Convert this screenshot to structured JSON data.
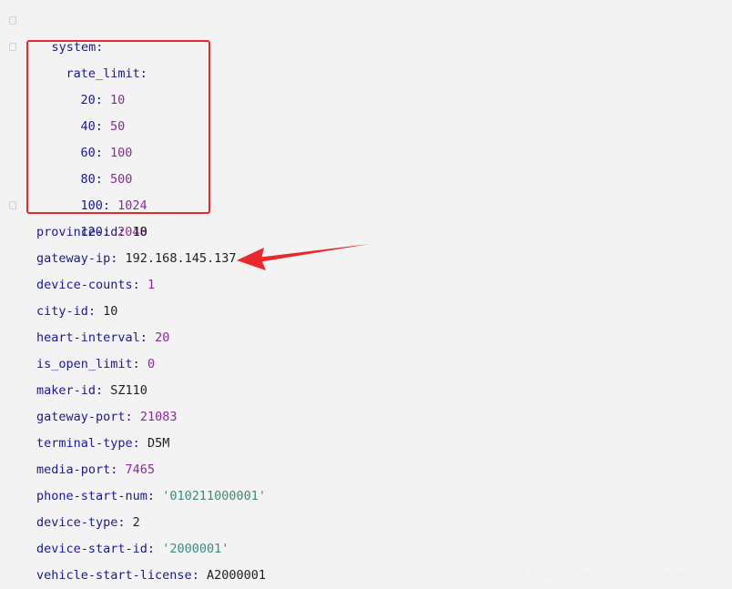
{
  "editor": {
    "root_key": "system",
    "rate_limit_key": "rate_limit",
    "rate_limit": [
      {
        "key": "20",
        "value": "10"
      },
      {
        "key": "40",
        "value": "50"
      },
      {
        "key": "60",
        "value": "100"
      },
      {
        "key": "80",
        "value": "500"
      },
      {
        "key": "100",
        "value": "1024"
      },
      {
        "key": "120",
        "value": "2048"
      }
    ],
    "entries": [
      {
        "key": "province-id",
        "value": "10",
        "kind": "plain"
      },
      {
        "key": "gateway-ip",
        "value": "192.168.145.137",
        "kind": "plain"
      },
      {
        "key": "device-counts",
        "value": "1",
        "kind": "num"
      },
      {
        "key": "city-id",
        "value": "10",
        "kind": "plain"
      },
      {
        "key": "heart-interval",
        "value": "20",
        "kind": "num"
      },
      {
        "key": "is_open_limit",
        "value": "0",
        "kind": "num"
      },
      {
        "key": "maker-id",
        "value": "SZ110",
        "kind": "plain"
      },
      {
        "key": "gateway-port",
        "value": "21083",
        "kind": "num"
      },
      {
        "key": "terminal-type",
        "value": "D5M",
        "kind": "plain"
      },
      {
        "key": "media-port",
        "value": "7465",
        "kind": "num"
      },
      {
        "key": "phone-start-num",
        "value": "'010211000001'",
        "kind": "str"
      },
      {
        "key": "device-type",
        "value": "2",
        "kind": "plain"
      },
      {
        "key": "device-start-id",
        "value": "'2000001'",
        "kind": "str"
      },
      {
        "key": "vehicle-start-license",
        "value": "A2000001",
        "kind": "plain"
      }
    ]
  },
  "annotations": {
    "highlight_color": "#e8282a",
    "arrow_color": "#e8282a"
  },
  "colors": {
    "background": "#f3f3f3",
    "key": "#1a1a8c",
    "number": "#8a2a9a",
    "string": "#3b8a7f",
    "plain": "#1f1f1f"
  },
  "watermark": "https://blog.csdn.net/wlwork66"
}
